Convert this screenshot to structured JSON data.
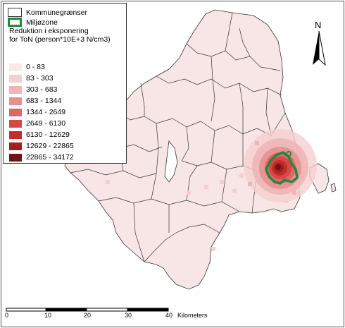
{
  "legend": {
    "boundary_label": "Kommunegrænser",
    "zone_label": "Miljøzone",
    "title_line1": "Reduktion i eksponering",
    "title_line2": "for ToN (person*10E+3 N/cm3)",
    "classes": [
      {
        "label": "0 - 83",
        "color": "#f7eaea"
      },
      {
        "label": "83 - 303",
        "color": "#f5cfcf"
      },
      {
        "label": "303 - 683",
        "color": "#efb4b4"
      },
      {
        "label": "683 - 1344",
        "color": "#e89090"
      },
      {
        "label": "1344 - 2649",
        "color": "#e06767"
      },
      {
        "label": "2649 - 6130",
        "color": "#d84646"
      },
      {
        "label": "6130 - 12629",
        "color": "#c42c2c"
      },
      {
        "label": "12629 - 22865",
        "color": "#9e2020"
      },
      {
        "label": "22865 - 34172",
        "color": "#6e1212"
      }
    ],
    "boundary_color": "#333333",
    "zone_color": "#1f8a3a"
  },
  "north_arrow": {
    "label": "N"
  },
  "scale_bar": {
    "ticks": [
      "0",
      "10",
      "20",
      "30",
      "40"
    ],
    "unit": "Kilometers"
  }
}
